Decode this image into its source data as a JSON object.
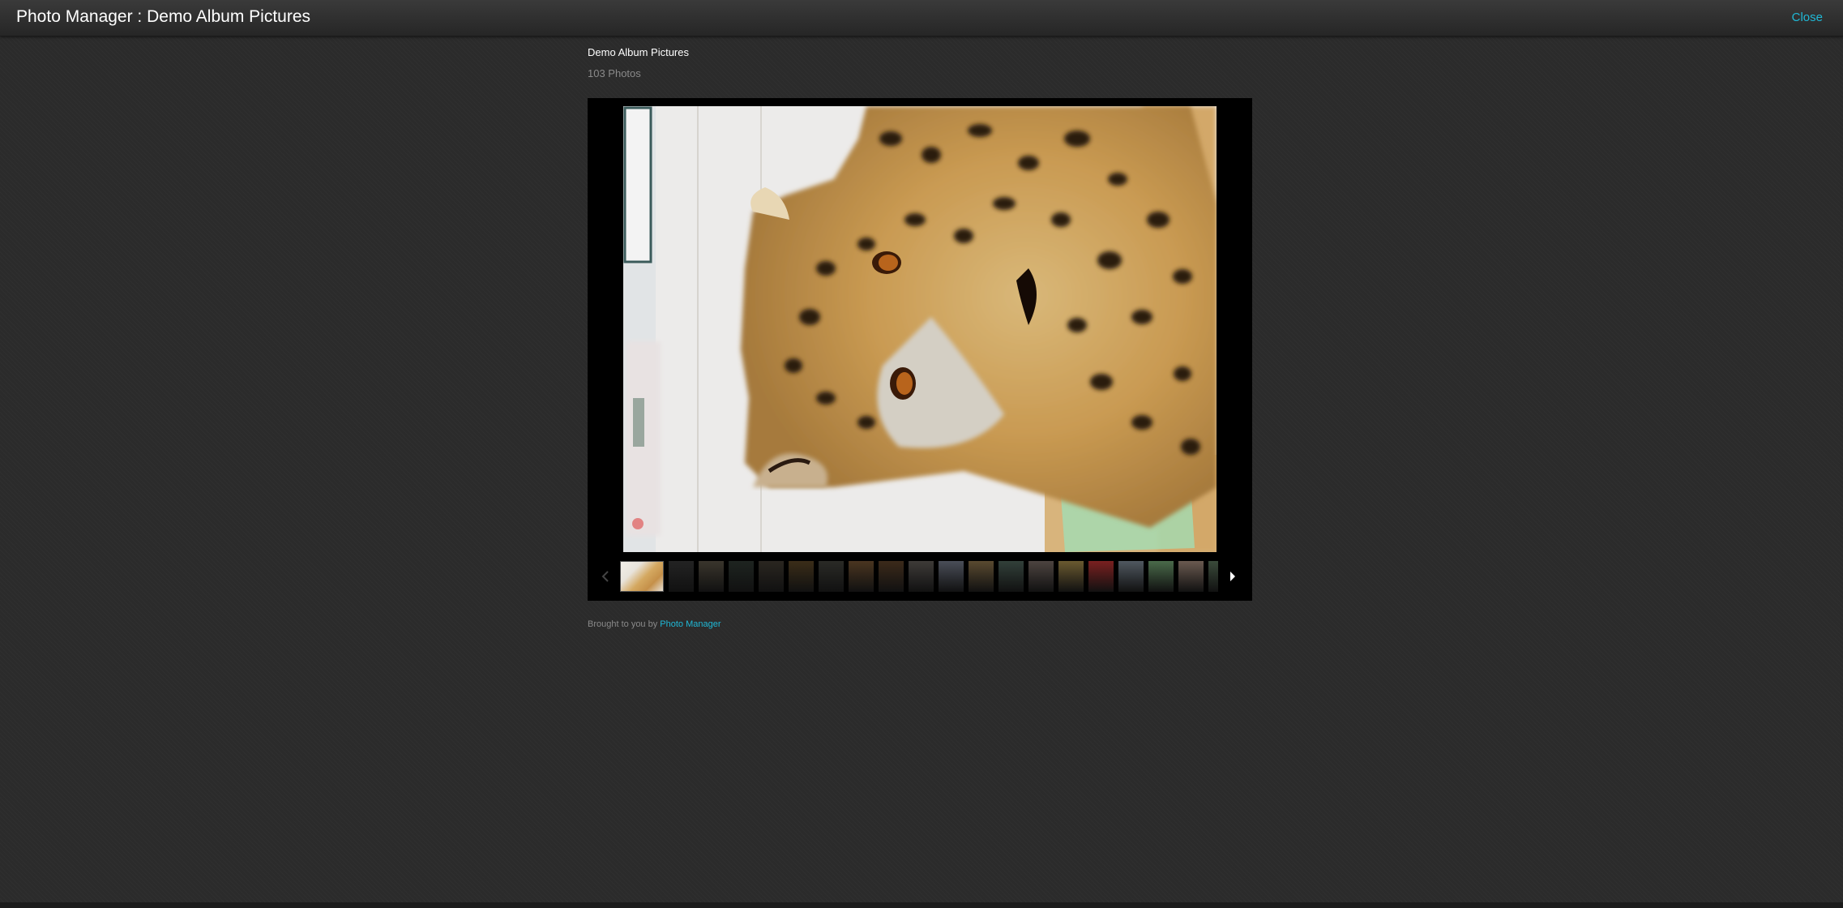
{
  "header": {
    "title": "Photo Manager : Demo Album Pictures",
    "close_label": "Close"
  },
  "album": {
    "title": "Demo Album Pictures",
    "count_label": "103 Photos"
  },
  "viewer": {
    "current_photo_icon": "jaguar-photo",
    "prev_icon": "chevron-left-icon",
    "next_icon": "chevron-right-icon",
    "thumbnails": [
      "#d9c38a",
      "#232323",
      "#3a352c",
      "#1e2420",
      "#2a2620",
      "#3b2d18",
      "#2a2a26",
      "#4a3520",
      "#3c2a1a",
      "#3e3b38",
      "#4a4e58",
      "#5a4a30",
      "#32403a",
      "#4d4440",
      "#6a5a30",
      "#7a2020",
      "#505860",
      "#4a6a4a",
      "#6a5a50",
      "#3a4a3a"
    ]
  },
  "footer": {
    "prefix": "Brought to you by",
    "link_label": "Photo Manager"
  },
  "colors": {
    "accent": "#1fb8d6",
    "background": "#2b2b2b",
    "viewer_background": "#000000"
  }
}
